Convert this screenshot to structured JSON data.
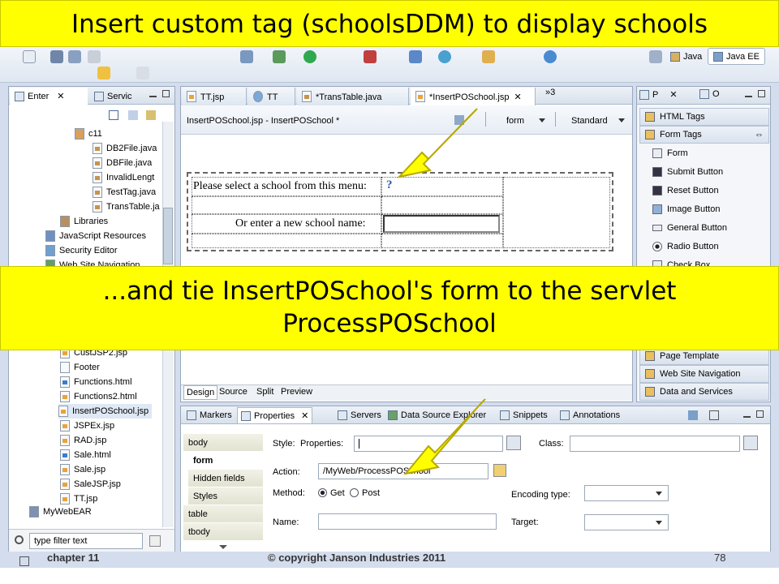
{
  "slide": {
    "title": "Insert custom tag (schoolsDDM) to display schools",
    "callout": "...and tie InsertPOSchool's form to the servlet ProcessPOSchool",
    "footer_left": "chapter 11",
    "footer_center": "© copyright Janson Industries 2011",
    "footer_right": "78"
  },
  "toolbar": {
    "perspective_java": "Java",
    "perspective_java_ee": "Java EE"
  },
  "left_panel": {
    "tabs": [
      "Enter",
      "Servic"
    ],
    "tree": [
      "c11",
      "DB2File.java",
      "DBFile.java",
      "InvalidLengt",
      "TestTag.java",
      "TransTable.ja",
      "Libraries",
      "JavaScript Resources",
      "Security Editor",
      "Web Site Navigation"
    ],
    "tree_lower": [
      "CustJSP2.jsp",
      "Footer",
      "Functions.html",
      "Functions2.html",
      "InsertPOSchool.jsp",
      "JSPEx.jsp",
      "RAD.jsp",
      "Sale.html",
      "Sale.jsp",
      "SaleJSP.jsp",
      "TT.jsp",
      "MyWebEAR"
    ],
    "filter_placeholder": "type filter text"
  },
  "editor": {
    "tabs": [
      "TT.jsp",
      "TT",
      "*TransTable.java",
      "*InsertPOSchool.jsp",
      "»3"
    ],
    "header_title": "InsertPOSchool.jsp - InsertPOSchool *",
    "header_form": "form",
    "header_standard": "Standard",
    "row1_label": "Please select a school from this menu:",
    "row1_marker": "?",
    "row2_label": "Or enter a new school name:",
    "bottom_tabs": [
      "Design",
      "Source",
      "Split",
      "Preview"
    ]
  },
  "palette": {
    "tabs": [
      "P",
      "O"
    ],
    "html_tags": "HTML Tags",
    "form_tags": "Form Tags",
    "items": [
      "Form",
      "Submit Button",
      "Reset Button",
      "Image Button",
      "General Button",
      "Radio Button",
      "Check Box"
    ],
    "drawers": [
      "Page Template",
      "Web Site Navigation",
      "Data and Services"
    ]
  },
  "properties": {
    "tabs": [
      "Markers",
      "Properties",
      "Servers",
      "Data Source Explorer",
      "Snippets",
      "Annotations"
    ],
    "side": [
      "body",
      "form",
      "Hidden fields",
      "Styles",
      "table",
      "tbody"
    ],
    "style_label": "Style:",
    "style_sublabel": "Properties:",
    "class_label": "Class:",
    "action_label": "Action:",
    "action_value": "/MyWeb/ProcessPOSchool",
    "method_label": "Method:",
    "method_get": "Get",
    "method_post": "Post",
    "encoding_label": "Encoding type:",
    "name_label": "Name:",
    "target_label": "Target:"
  }
}
